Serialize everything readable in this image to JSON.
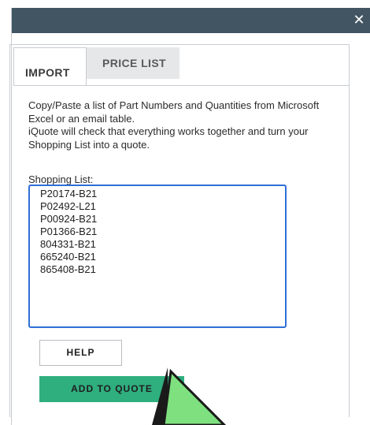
{
  "dialog": {
    "close_icon": "close-icon",
    "close_glyph": "✕"
  },
  "tabs": [
    {
      "label": "IMPORT",
      "active": true
    },
    {
      "label": "PRICE LIST",
      "active": false
    }
  ],
  "import": {
    "description_line1": "Copy/Paste a list of Part Numbers and Quantities from Microsoft Excel or an email table.",
    "description_line2": "iQuote will check that everything works together and turn your Shopping List into a quote.",
    "list_label": "Shopping List:",
    "items": [
      "P20174-B21",
      "P02492-L21",
      "P00924-B21",
      "P01366-B21",
      "804331-B21",
      "665240-B21",
      "865408-B21"
    ],
    "help_label": "HELP",
    "add_label": "ADD TO QUOTE"
  },
  "colors": {
    "titlebar": "#425563",
    "accent_green": "#2fae7e",
    "focus_blue": "#2e6fd6",
    "cursor_fill": "#7ee07e"
  }
}
